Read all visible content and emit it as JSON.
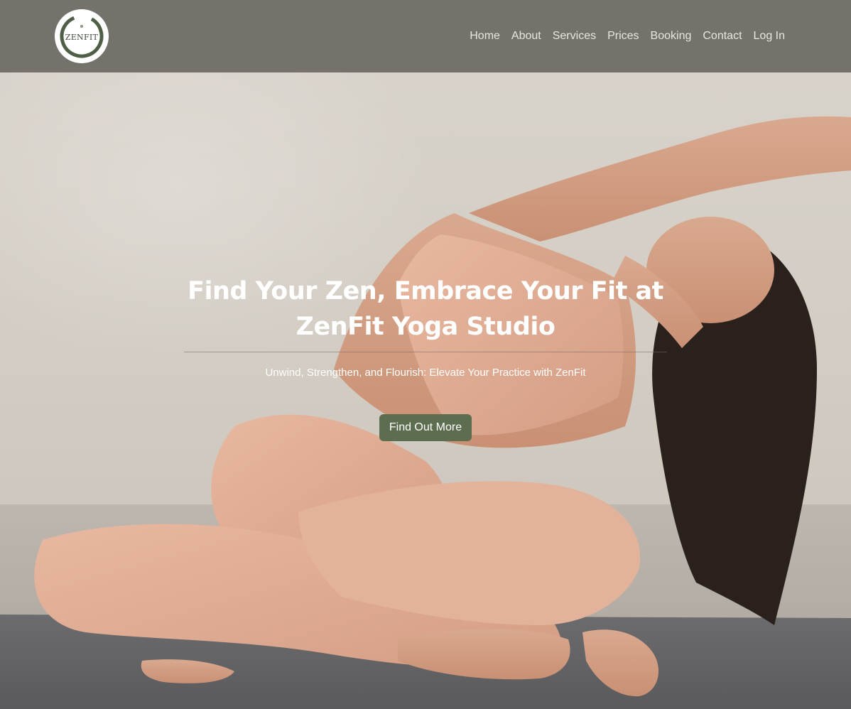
{
  "brand": {
    "logo_text": "ZENFIT",
    "logo_ring_color": "#4f5f45"
  },
  "nav": {
    "items": [
      {
        "label": "Home"
      },
      {
        "label": "About"
      },
      {
        "label": "Services"
      },
      {
        "label": "Prices"
      },
      {
        "label": "Booking"
      },
      {
        "label": "Contact"
      },
      {
        "label": "Log In"
      }
    ]
  },
  "hero": {
    "title": "Find Your Zen, Embrace Your Fit at ZenFit Yoga Studio",
    "subtitle": "Unwind, Strengthen, and Flourish: Elevate Your Practice with ZenFit",
    "cta_label": "Find Out More",
    "background_image": "yoga-woman-side-stretch-photo"
  },
  "colors": {
    "navbar_bg": "#6c6963",
    "accent_green": "#5c6e4f",
    "nav_text": "#e9e6e0",
    "hero_text": "#ffffff"
  }
}
